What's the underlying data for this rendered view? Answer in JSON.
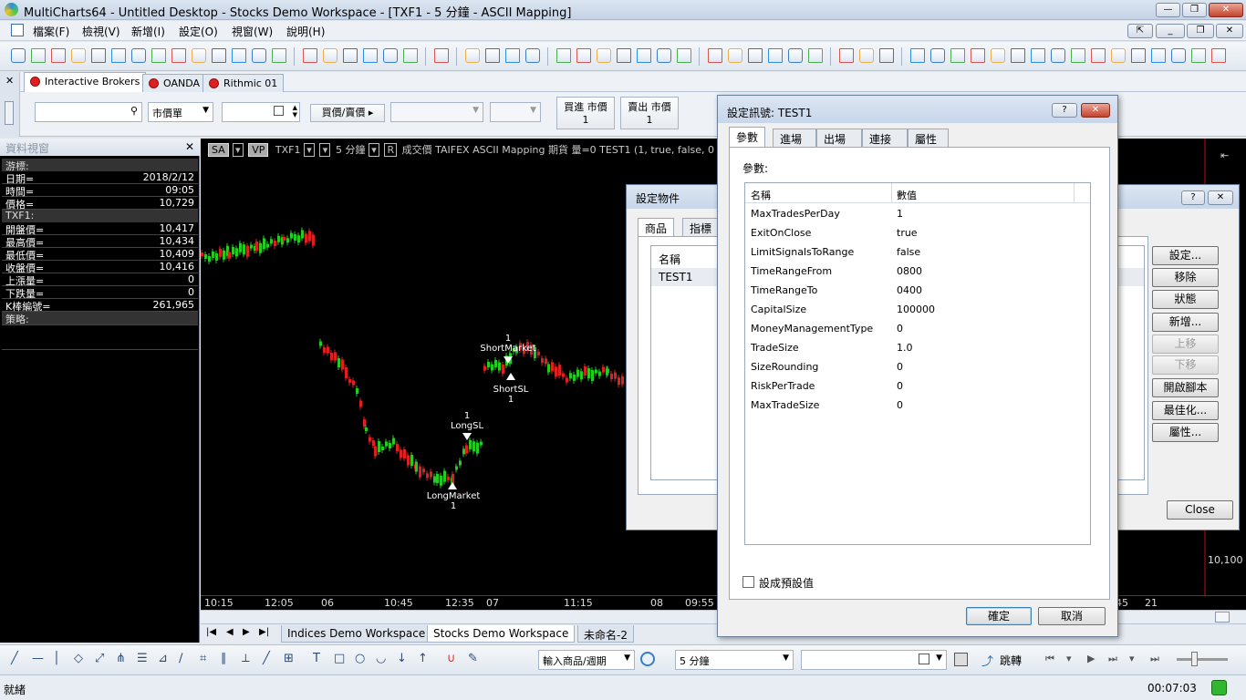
{
  "window": {
    "title": "MultiCharts64 - Untitled Desktop - Stocks Demo Workspace - [TXF1 - 5 分鐘 - ASCII Mapping]"
  },
  "menu": [
    "檔案(F)",
    "檢視(V)",
    "新增(I)",
    "設定(O)",
    "視窗(W)",
    "說明(H)"
  ],
  "broker_tabs": [
    "Interactive Brokers",
    "OANDA",
    "Rithmic 01"
  ],
  "order_bar": {
    "order_type": "市價單",
    "buy_sell": "買價/賣價",
    "buy_label": "買進 市價",
    "buy_qty": "1",
    "sell_label": "賣出 市價",
    "sell_qty": "1"
  },
  "data_window": {
    "title": "資料視窗",
    "cursor_label": "游標:",
    "date_label": "日期=",
    "date": "2018/2/12",
    "time_label": "時間=",
    "time": "09:05",
    "price_label": "價格=",
    "price": "10,729",
    "symbol_label": "TXF1:",
    "open_label": "開盤價=",
    "open": "10,417",
    "high_label": "最高價=",
    "high": "10,434",
    "low_label": "最低價=",
    "low": "10,409",
    "close_label": "收盤價=",
    "close": "10,416",
    "upvol_label": "上漲量=",
    "upvol": "0",
    "downvol_label": "下跌量=",
    "downvol": "0",
    "bar_label": "K棒編號=",
    "bar": "261,965",
    "strategy_label": "策略:"
  },
  "chart": {
    "info_sa": "SA",
    "info_vp": "VP",
    "symbol": "TXF1",
    "interval": "5 分鐘",
    "r_label": "R",
    "info_rest": "成交價  TAIFEX  ASCII Mapping  期貨  量=0  TEST1 (1,  true,  false,  0",
    "price_label": "10,100",
    "time_ticks": [
      "10:15",
      "12:05",
      "06",
      "10:45",
      "12:35",
      "07",
      "11:15",
      "08",
      "09:55",
      "45",
      "21"
    ],
    "signals": {
      "short_market": "ShortMarket",
      "short_market_qty": "1",
      "short_sl": "ShortSL",
      "short_sl_qty": "1",
      "long_sl": "LongSL",
      "long_sl_qty": "1",
      "long_market": "LongMarket",
      "long_market_qty": "1"
    },
    "up_color": "#22cc22",
    "down_color": "#e02020"
  },
  "workspace_tabs": [
    "Indices Demo Workspace",
    "Stocks Demo Workspace",
    "未命名-2"
  ],
  "drawbar": {
    "symbol_input": "輸入商品/週期",
    "interval_select": "5 分鐘",
    "jump_label": "跳轉"
  },
  "status": {
    "text": "就緒",
    "clock": "00:07:03"
  },
  "setup_objects": {
    "title": "設定物件",
    "tabs": [
      "商品",
      "指標"
    ],
    "col_name": "名稱",
    "row": "TEST1",
    "buttons": [
      "設定...",
      "移除",
      "狀態",
      "新增...",
      "上移",
      "下移",
      "開啟腳本",
      "最佳化...",
      "屬性..."
    ],
    "close": "Close"
  },
  "signal_dialog": {
    "title": "設定訊號: TEST1",
    "tabs": [
      "參數",
      "進場",
      "出場",
      "連接線",
      "屬性"
    ],
    "section_label": "參數:",
    "col_name": "名稱",
    "col_value": "數值",
    "params": [
      {
        "name": "MaxTradesPerDay",
        "value": "1"
      },
      {
        "name": "ExitOnClose",
        "value": "true"
      },
      {
        "name": "LimitSignalsToRange",
        "value": "false"
      },
      {
        "name": "TimeRangeFrom",
        "value": "0800"
      },
      {
        "name": "TimeRangeTo",
        "value": "0400"
      },
      {
        "name": "CapitalSize",
        "value": "100000"
      },
      {
        "name": "MoneyManagementType",
        "value": "0"
      },
      {
        "name": "TradeSize",
        "value": "1.0"
      },
      {
        "name": "SizeRounding",
        "value": "0"
      },
      {
        "name": "RiskPerTrade",
        "value": "0"
      },
      {
        "name": "MaxTradeSize",
        "value": "0"
      }
    ],
    "default_checkbox": "設成預設值",
    "ok": "確定",
    "cancel": "取消"
  }
}
